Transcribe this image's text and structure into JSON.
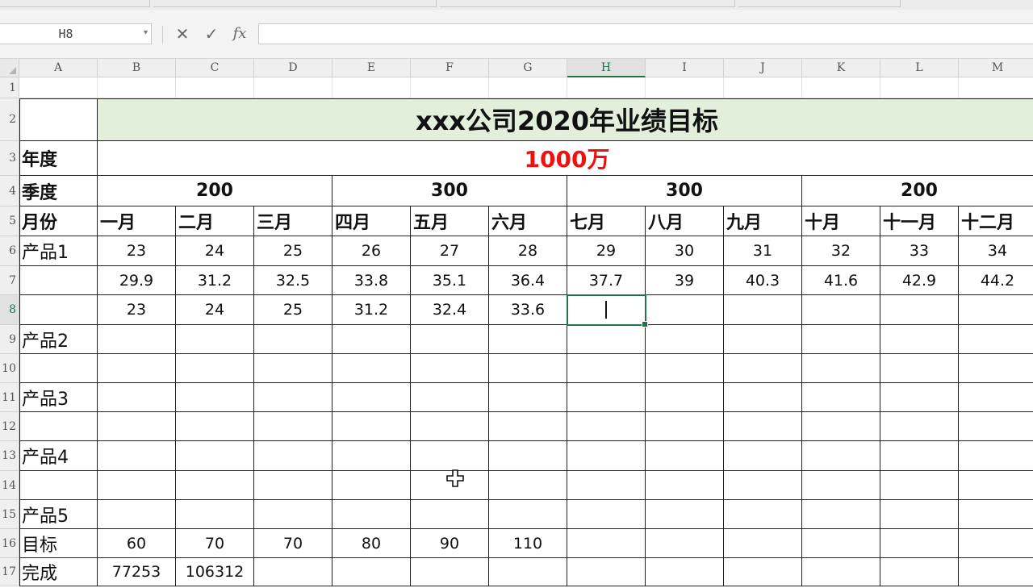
{
  "formula_bar": {
    "name_box": "H8",
    "cancel_icon": "✕",
    "enter_icon": "✓",
    "function_icon": "fx",
    "formula": ""
  },
  "columns": [
    "A",
    "B",
    "C",
    "D",
    "E",
    "F",
    "G",
    "H",
    "I",
    "J",
    "K",
    "L",
    "M"
  ],
  "selected_column": "H",
  "rows": [
    "1",
    "2",
    "3",
    "4",
    "5",
    "6",
    "7",
    "8",
    "9",
    "10",
    "11",
    "12",
    "13",
    "14",
    "15",
    "16",
    "17"
  ],
  "selected_row": "8",
  "table": {
    "title": "xxx公司2020年业绩目标",
    "year_label": "年度",
    "year_total": "1000万",
    "quarter_label": "季度",
    "quarters": [
      "200",
      "300",
      "300",
      "200"
    ],
    "month_label": "月份",
    "months": [
      "一月",
      "二月",
      "三月",
      "四月",
      "五月",
      "六月",
      "七月",
      "八月",
      "九月",
      "十月",
      "十一月",
      "十二月"
    ],
    "product1_label": "产品1",
    "product1_row1": [
      "23",
      "24",
      "25",
      "26",
      "27",
      "28",
      "29",
      "30",
      "31",
      "32",
      "33",
      "34"
    ],
    "product1_row2": [
      "29.9",
      "31.2",
      "32.5",
      "33.8",
      "35.1",
      "36.4",
      "37.7",
      "39",
      "40.3",
      "41.6",
      "42.9",
      "44.2"
    ],
    "product1_row3": [
      "23",
      "24",
      "25",
      "31.2",
      "32.4",
      "33.6",
      "",
      "",
      "",
      "",
      "",
      ""
    ],
    "product2_label": "产品2",
    "product3_label": "产品3",
    "product4_label": "产品4",
    "product5_label": "产品5",
    "target_label": "目标",
    "target_values": [
      "60",
      "70",
      "70",
      "80",
      "90",
      "110",
      "",
      "",
      "",
      "",
      "",
      ""
    ],
    "done_label": "完成",
    "done_values": [
      "77253",
      "106312",
      "",
      "",
      "",
      "",
      "",
      "",
      "",
      "",
      "",
      ""
    ]
  },
  "active_cell": "H8",
  "colors": {
    "title_fill": "#e2efda",
    "total_text": "#ee1111",
    "selection": "#217346"
  }
}
